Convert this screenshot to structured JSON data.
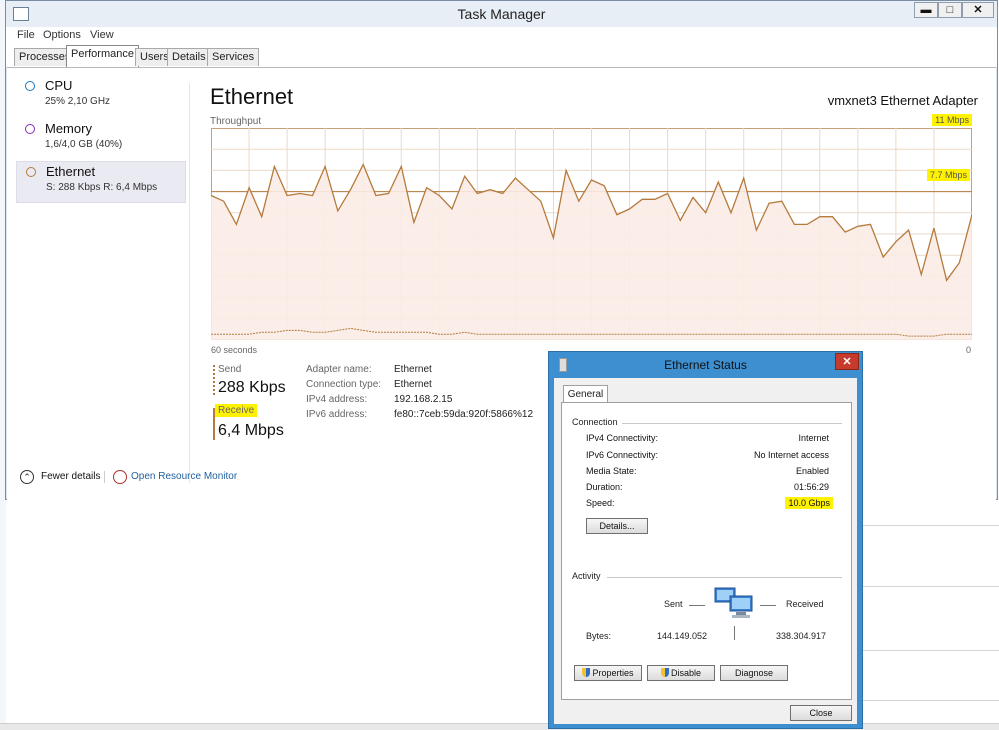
{
  "task_manager": {
    "title": "Task Manager",
    "menu": [
      "File",
      "Options",
      "View"
    ],
    "window_buttons": {
      "minimize": "▬",
      "maximize": "□",
      "close": "✕"
    },
    "tabs": [
      "Processes",
      "Performance",
      "Users",
      "Details",
      "Services"
    ],
    "active_tab": "Performance",
    "sidebar": [
      {
        "title": "CPU",
        "sub": "25%  2,10 GHz",
        "color": "#1a7bc4"
      },
      {
        "title": "Memory",
        "sub": "1,6/4,0 GB (40%)",
        "color": "#8b2fb5"
      },
      {
        "title": "Ethernet",
        "sub": "S: 288 Kbps  R: 6,4 Mbps",
        "color": "#b57a3c",
        "selected": true
      }
    ],
    "page_title": "Ethernet",
    "adapter": "vmxnet3 Ethernet Adapter",
    "throughput_label": "Throughput",
    "y_max_label": "11 Mbps",
    "y_mid_label": "7.7 Mbps",
    "x_left_label": "60 seconds",
    "x_right_label": "0",
    "send_label": "Send",
    "send_value": "288 Kbps",
    "receive_label": "Receive",
    "receive_value": "6,4 Mbps",
    "properties": [
      {
        "label": "Adapter name:",
        "value": "Ethernet"
      },
      {
        "label": "Connection type:",
        "value": "Ethernet"
      },
      {
        "label": "IPv4 address:",
        "value": "192.168.2.15"
      },
      {
        "label": "IPv6 address:",
        "value": "fe80::7ceb:59da:920f:5866%12"
      }
    ],
    "fewer_details": "Fewer details",
    "open_resource_monitor": "Open Resource Monitor"
  },
  "chart_data": {
    "type": "line",
    "y_unit": "Mbps",
    "ylim": [
      0,
      11
    ],
    "x_range_seconds": [
      60,
      0
    ],
    "series": [
      {
        "name": "Receive",
        "values": [
          7.5,
          7.2,
          6.0,
          7.9,
          6.4,
          9.0,
          7.5,
          7.6,
          7.5,
          9.0,
          6.7,
          7.8,
          9.1,
          7.5,
          7.6,
          9.0,
          6.1,
          7.9,
          7.5,
          6.8,
          8.5,
          7.6,
          7.8,
          7.6,
          8.4,
          7.8,
          7.2,
          5.3,
          8.8,
          7.2,
          8.3,
          8.0,
          6.5,
          6.8,
          7.3,
          7.3,
          7.6,
          6.2,
          7.4,
          6.6,
          8.2,
          6.6,
          8.4,
          5.7,
          7.1,
          7.2,
          6.0,
          6.0,
          6.4,
          6.4,
          5.6,
          5.9,
          6.0,
          4.3,
          5.1,
          5.7,
          3.4,
          5.8,
          3.1,
          4.0,
          6.5
        ]
      },
      {
        "name": "Send",
        "values": [
          0.3,
          0.3,
          0.3,
          0.3,
          0.4,
          0.4,
          0.5,
          0.5,
          0.4,
          0.4,
          0.5,
          0.6,
          0.5,
          0.4,
          0.4,
          0.4,
          0.4,
          0.4,
          0.3,
          0.3,
          0.4,
          0.3,
          0.3,
          0.3,
          0.3,
          0.3,
          0.3,
          0.3,
          0.3,
          0.3,
          0.3,
          0.3,
          0.3,
          0.3,
          0.3,
          0.3,
          0.3,
          0.3,
          0.3,
          0.3,
          0.3,
          0.3,
          0.3,
          0.3,
          0.3,
          0.3,
          0.3,
          0.3,
          0.3,
          0.3,
          0.3,
          0.3,
          0.3,
          0.3,
          0.3,
          0.2,
          0.2,
          0.2,
          0.3,
          0.3,
          0.3
        ]
      }
    ],
    "reference_line": 7.7,
    "colors": {
      "line": "#b57a3c",
      "fill": "#fbece6",
      "grid": "#ead8c8",
      "border": "#c8a078"
    }
  },
  "ethernet_status": {
    "title": "Ethernet Status",
    "close_glyph": "✕",
    "tab": "General",
    "connection_header": "Connection",
    "rows": [
      {
        "label": "IPv4 Connectivity:",
        "value": "Internet"
      },
      {
        "label": "IPv6 Connectivity:",
        "value": "No Internet access"
      },
      {
        "label": "Media State:",
        "value": "Enabled"
      },
      {
        "label": "Duration:",
        "value": "01:56:29"
      },
      {
        "label": "Speed:",
        "value": "10.0 Gbps"
      }
    ],
    "details_button": "Details...",
    "activity_header": "Activity",
    "sent_label": "Sent",
    "received_label": "Received",
    "bytes_label": "Bytes:",
    "bytes_sent": "144.149.052",
    "bytes_received": "338.304.917",
    "properties_button": "Properties",
    "disable_button": "Disable",
    "diagnose_button": "Diagnose",
    "close_button": "Close"
  }
}
